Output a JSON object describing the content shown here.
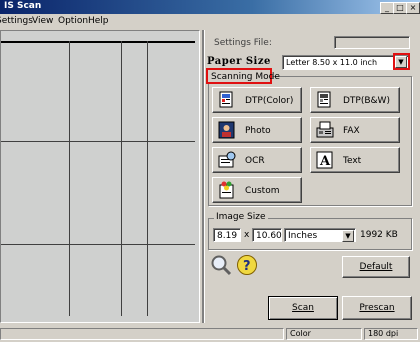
{
  "window": {
    "title": "IS Scan",
    "min_glyph": "_",
    "max_glyph": "□",
    "close_glyph": "×"
  },
  "menu": [
    {
      "label": "Settings"
    },
    {
      "label": "View"
    },
    {
      "label": "Option"
    },
    {
      "label": "Help"
    }
  ],
  "settings_file": {
    "label": "Settings File:",
    "value": ""
  },
  "paper_size": {
    "label": "Paper Size",
    "value": "Letter 8.50 x 11.0 inch",
    "arrow": "▼"
  },
  "scanning_mode": {
    "label": "Scanning Mode",
    "modes": [
      {
        "label": "DTP(Color)",
        "icon": "dtp-color-icon"
      },
      {
        "label": "DTP(B&W)",
        "icon": "dtp-bw-icon"
      },
      {
        "label": "Photo",
        "icon": "photo-icon"
      },
      {
        "label": "FAX",
        "icon": "fax-icon"
      },
      {
        "label": "OCR",
        "icon": "ocr-icon"
      },
      {
        "label": "Text",
        "icon": "text-icon"
      },
      {
        "label": "Custom",
        "icon": "custom-icon"
      }
    ]
  },
  "image_size": {
    "label": "Image Size",
    "width": "8.19",
    "times": "x",
    "height": "10.60",
    "unit": "Inches",
    "size": "1992 KB"
  },
  "buttons": {
    "default": "Default",
    "scan": "Scan",
    "prescan": "Prescan"
  },
  "status": {
    "mode": "Color",
    "dpi": "180 dpi"
  },
  "colors": {
    "titlebar_start": "#0a246a",
    "highlight_red": "#e01010",
    "face": "#d4d0c8"
  }
}
